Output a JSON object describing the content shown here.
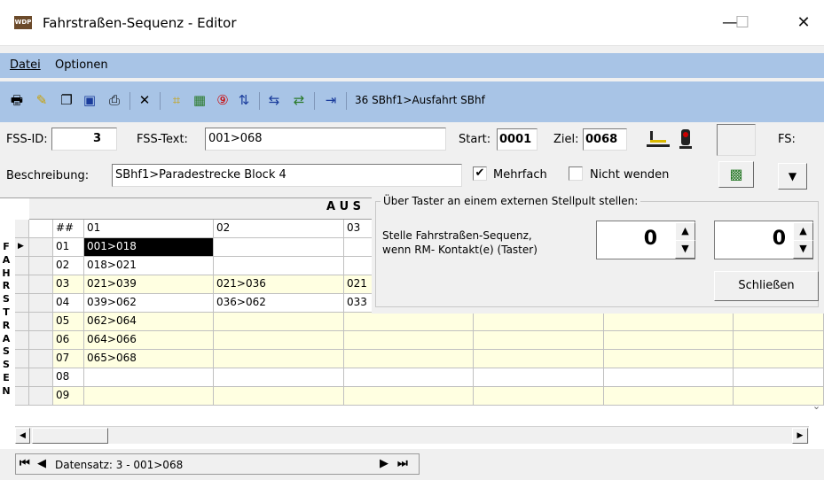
{
  "window": {
    "title": "Fahrstraßen-Sequenz - Editor",
    "icon_text": "WDP",
    "minimize": "—",
    "maximize": "☐",
    "close": "✕"
  },
  "menu": {
    "datei": "Datei",
    "optionen": "Optionen"
  },
  "toolbar": {
    "info_text": "36 SBhf1>Ausfahrt SBhf"
  },
  "form": {
    "fss_id_label": "FSS-ID:",
    "fss_id_value": "3",
    "fss_text_label": "FSS-Text:",
    "fss_text_value": "001>068",
    "start_label": "Start:",
    "start_value": "0001",
    "ziel_label": "Ziel:",
    "ziel_value": "0068",
    "fs_label": "FS:",
    "beschreibung_label": "Beschreibung:",
    "beschreibung_value": "SBhf1>Paradestrecke Block 4",
    "mehrfach_label": "Mehrfach",
    "mehrfach_checked": true,
    "nicht_wenden_label": "Nicht wenden",
    "nicht_wenden_checked": false
  },
  "grid": {
    "header_banner": "A U S",
    "side_label": "FAHRSTRASSEN",
    "columns": [
      "##",
      "01",
      "02",
      "03"
    ],
    "rows": [
      {
        "n": "01",
        "c1": "001>018",
        "c2": "",
        "c3": ""
      },
      {
        "n": "02",
        "c1": "018>021",
        "c2": "",
        "c3": ""
      },
      {
        "n": "03",
        "c1": "021>039",
        "c2": "021>036",
        "c3": "021"
      },
      {
        "n": "04",
        "c1": "039>062",
        "c2": "036>062",
        "c3": "033"
      },
      {
        "n": "05",
        "c1": "062>064",
        "c2": "",
        "c3": ""
      },
      {
        "n": "06",
        "c1": "064>066",
        "c2": "",
        "c3": ""
      },
      {
        "n": "07",
        "c1": "065>068",
        "c2": "",
        "c3": ""
      },
      {
        "n": "08",
        "c1": "",
        "c2": "",
        "c3": ""
      },
      {
        "n": "09",
        "c1": "",
        "c2": "",
        "c3": ""
      }
    ]
  },
  "panel": {
    "group_title": "Über Taster an einem externen Stellpult stellen:",
    "desc_line1": "Stelle Fahrstraßen-Sequenz,",
    "desc_line2": "wenn RM- Kontakt(e) (Taster)",
    "spin1_value": "0",
    "spin2_value": "0",
    "close_button": "Schließen"
  },
  "navigator": {
    "record_text": "Datensatz: 3 - 001>068"
  }
}
